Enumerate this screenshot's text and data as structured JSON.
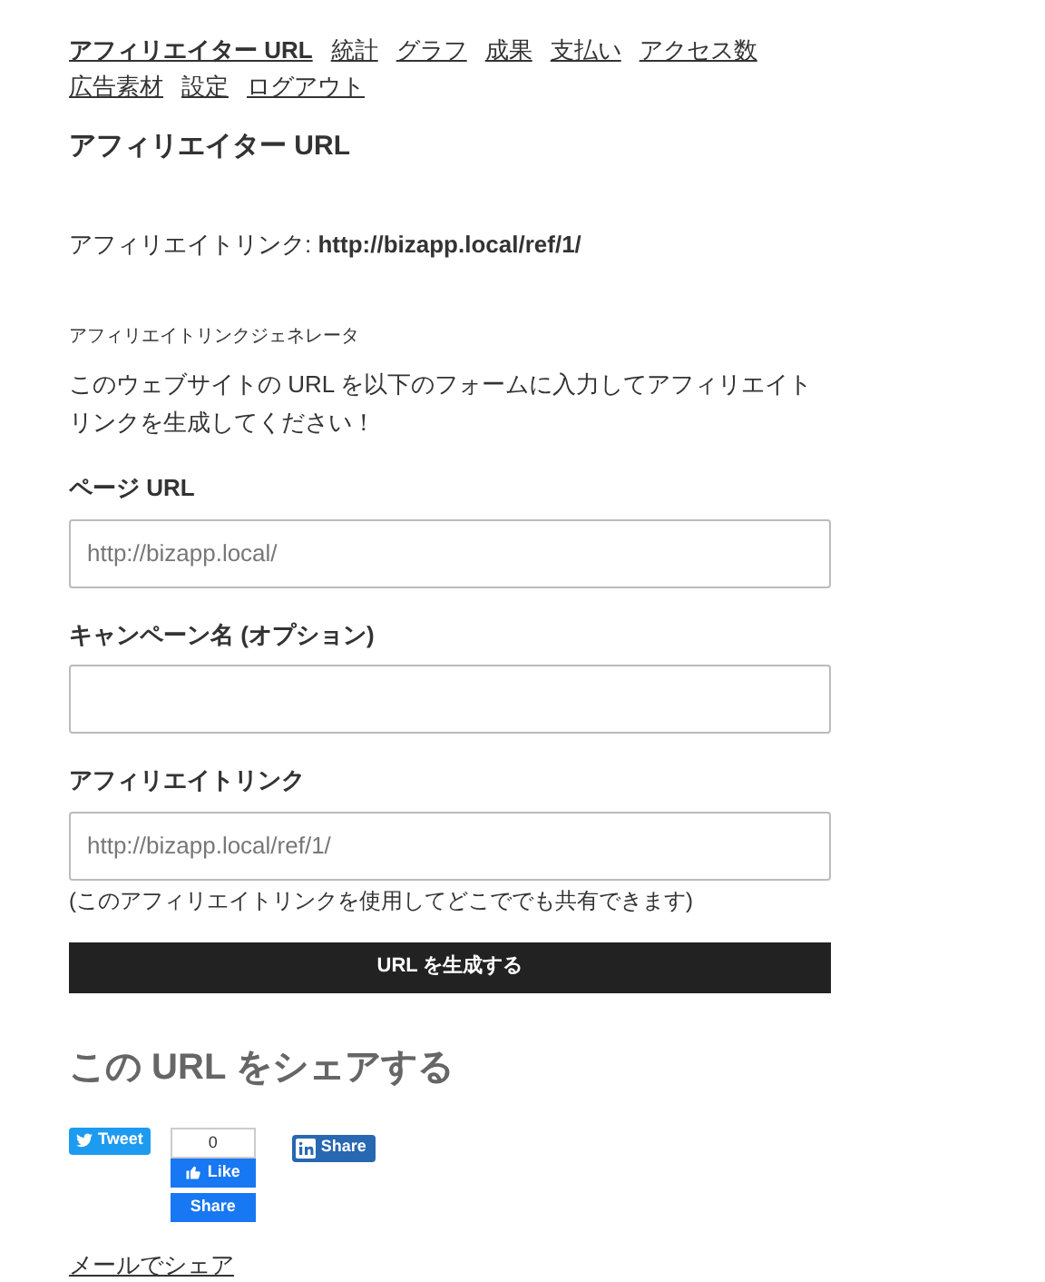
{
  "nav": [
    {
      "label": "アフィリエイター URL",
      "selected": true
    },
    {
      "label": "統計",
      "selected": false
    },
    {
      "label": "グラフ",
      "selected": false
    },
    {
      "label": "成果",
      "selected": false
    },
    {
      "label": "支払い",
      "selected": false
    },
    {
      "label": "アクセス数",
      "selected": false
    },
    {
      "label": "広告素材",
      "selected": false
    },
    {
      "label": "設定",
      "selected": false
    },
    {
      "label": "ログアウト",
      "selected": false
    }
  ],
  "title": "アフィリエイター URL",
  "affiliate_link": "アフィリエイトリンク: **http://bizapp.local/ref/1/**",
  "generator": {
    "heading": "アフィリエイトリンクジェネレータ",
    "description": "このウェブサイトの URL を以下のフォームに入力してアフィリエイトリンクを生成してください！",
    "fields": [
      {
        "label": "ページ URL",
        "value": "http://bizapp.local/"
      },
      {
        "label": "キャンペーン名 (オプション)"
      },
      {
        "label": "アフィリエイトリンク",
        "value": "http://bizapp.local/ref/1/",
        "note": "(このアフィリエイトリンクを使用してどこででも共有できます)"
      }
    ],
    "button": "URL を生成する"
  },
  "share": {
    "heading": "この URL をシェアする",
    "tweet": "Tweet",
    "like_count": "0",
    "like": "Like",
    "fb_share": "Share",
    "linkedin": "Share",
    "email": "メールでシェア"
  }
}
